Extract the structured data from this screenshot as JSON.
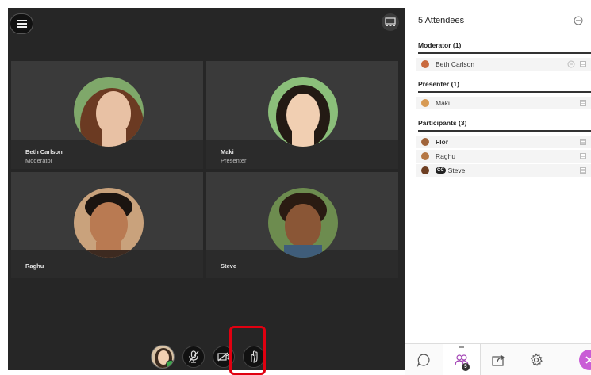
{
  "stage": {
    "tiles": [
      {
        "name": "Beth Carlson",
        "role": "Moderator",
        "skin": "#e8c1a4",
        "hair": "#6b3a22",
        "bg": "#7fa86a"
      },
      {
        "name": "Maki",
        "role": "Presenter",
        "skin": "#f1cfb2",
        "hair": "#231a14",
        "bg": "#8bbf7a"
      },
      {
        "name": "Raghu",
        "role": "",
        "skin": "#b97a52",
        "hair": "#1b1410",
        "bg": "#c9a27c"
      },
      {
        "name": "Steve",
        "role": "",
        "skin": "#8a5636",
        "hair": "#2a1b12",
        "bg": "#6d8c4f"
      }
    ]
  },
  "panel": {
    "title": "5 Attendees",
    "sections": [
      {
        "heading": "Moderator (1)",
        "rows": [
          {
            "name": "Beth Carlson",
            "av": "#c96a3e",
            "cc": false
          }
        ]
      },
      {
        "heading": "Presenter (1)",
        "rows": [
          {
            "name": "Maki",
            "av": "#d79a54",
            "cc": false
          }
        ]
      },
      {
        "heading": "Participants (3)",
        "rows": [
          {
            "name": "Flor",
            "av": "#a0643a",
            "cc": false
          },
          {
            "name": "Raghu",
            "av": "#b57744",
            "cc": false
          },
          {
            "name": "Steve",
            "av": "#6e3f22",
            "cc": true
          }
        ]
      }
    ],
    "cc_label": "CC",
    "attendee_badge": "5"
  },
  "colors": {
    "accent": "#c95cd6",
    "highlight": "#e00010",
    "ok": "#3aa84a"
  }
}
